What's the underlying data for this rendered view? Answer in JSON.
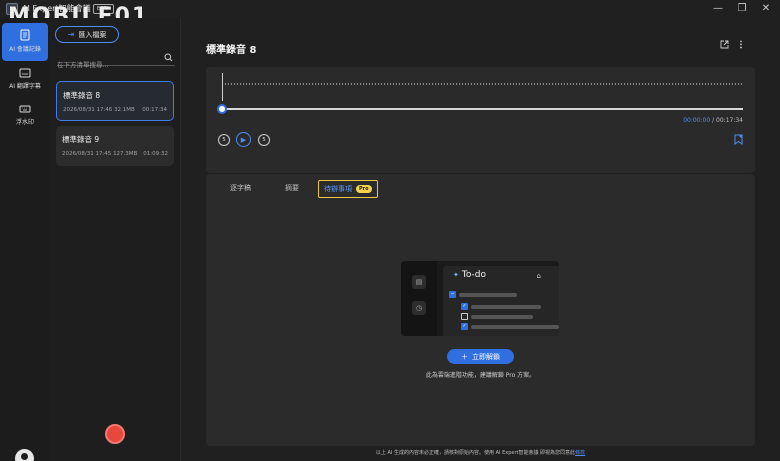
{
  "titlebar": {
    "app_title": "AI Expert智能會議",
    "beta_badge": "BETA",
    "watermark": "MOBILE01",
    "minimize": "—",
    "maximize": "❐",
    "close": "✕"
  },
  "rail": {
    "items": [
      {
        "label": "AI 會議記錄",
        "icon": "document-icon",
        "active": true
      },
      {
        "label": "AI 翻譯字幕",
        "icon": "subtitle-icon",
        "active": false
      },
      {
        "label": "浮水印",
        "icon": "keyboard-icon",
        "active": false
      }
    ],
    "avatar_icon": "user-avatar-icon"
  },
  "list": {
    "import_label": "匯入檔案",
    "search_placeholder": "在下方清單搜尋...",
    "recordings": [
      {
        "title": "標準錄音 8",
        "datetime": "2026/08/31 17:46",
        "size": "32.1MB",
        "duration": "00:17:34",
        "selected": true
      },
      {
        "title": "標準錄音 9",
        "datetime": "2026/08/31 17:45",
        "size": "127.3MB",
        "duration": "01:09:32",
        "selected": false
      }
    ]
  },
  "main": {
    "title": "標準錄音 8",
    "player": {
      "current_time": "00:00:00",
      "separator": "/",
      "total_time": "00:17:34",
      "progress": 0,
      "skip_back": "5",
      "skip_fwd": "5"
    },
    "tabs": [
      {
        "label": "逐字稿",
        "active": false
      },
      {
        "label": "摘要",
        "active": false
      },
      {
        "label": "待辦事項",
        "active": true,
        "badge": "Pro"
      }
    ],
    "illustration": {
      "title": "To-do"
    },
    "unlock_label": "立即解鎖",
    "unlock_note": "此為雲端進階功能，建議解鎖 Pro 方案。"
  },
  "footer": {
    "note": "以上 AI 生成的內容未必正確，請核對原始內容。使用 AI Expert智能會議 即視為您同意此",
    "link": "條款"
  },
  "colors": {
    "accent": "#2f6fe0",
    "record": "#e8473c",
    "pro": "#f5d34c"
  }
}
